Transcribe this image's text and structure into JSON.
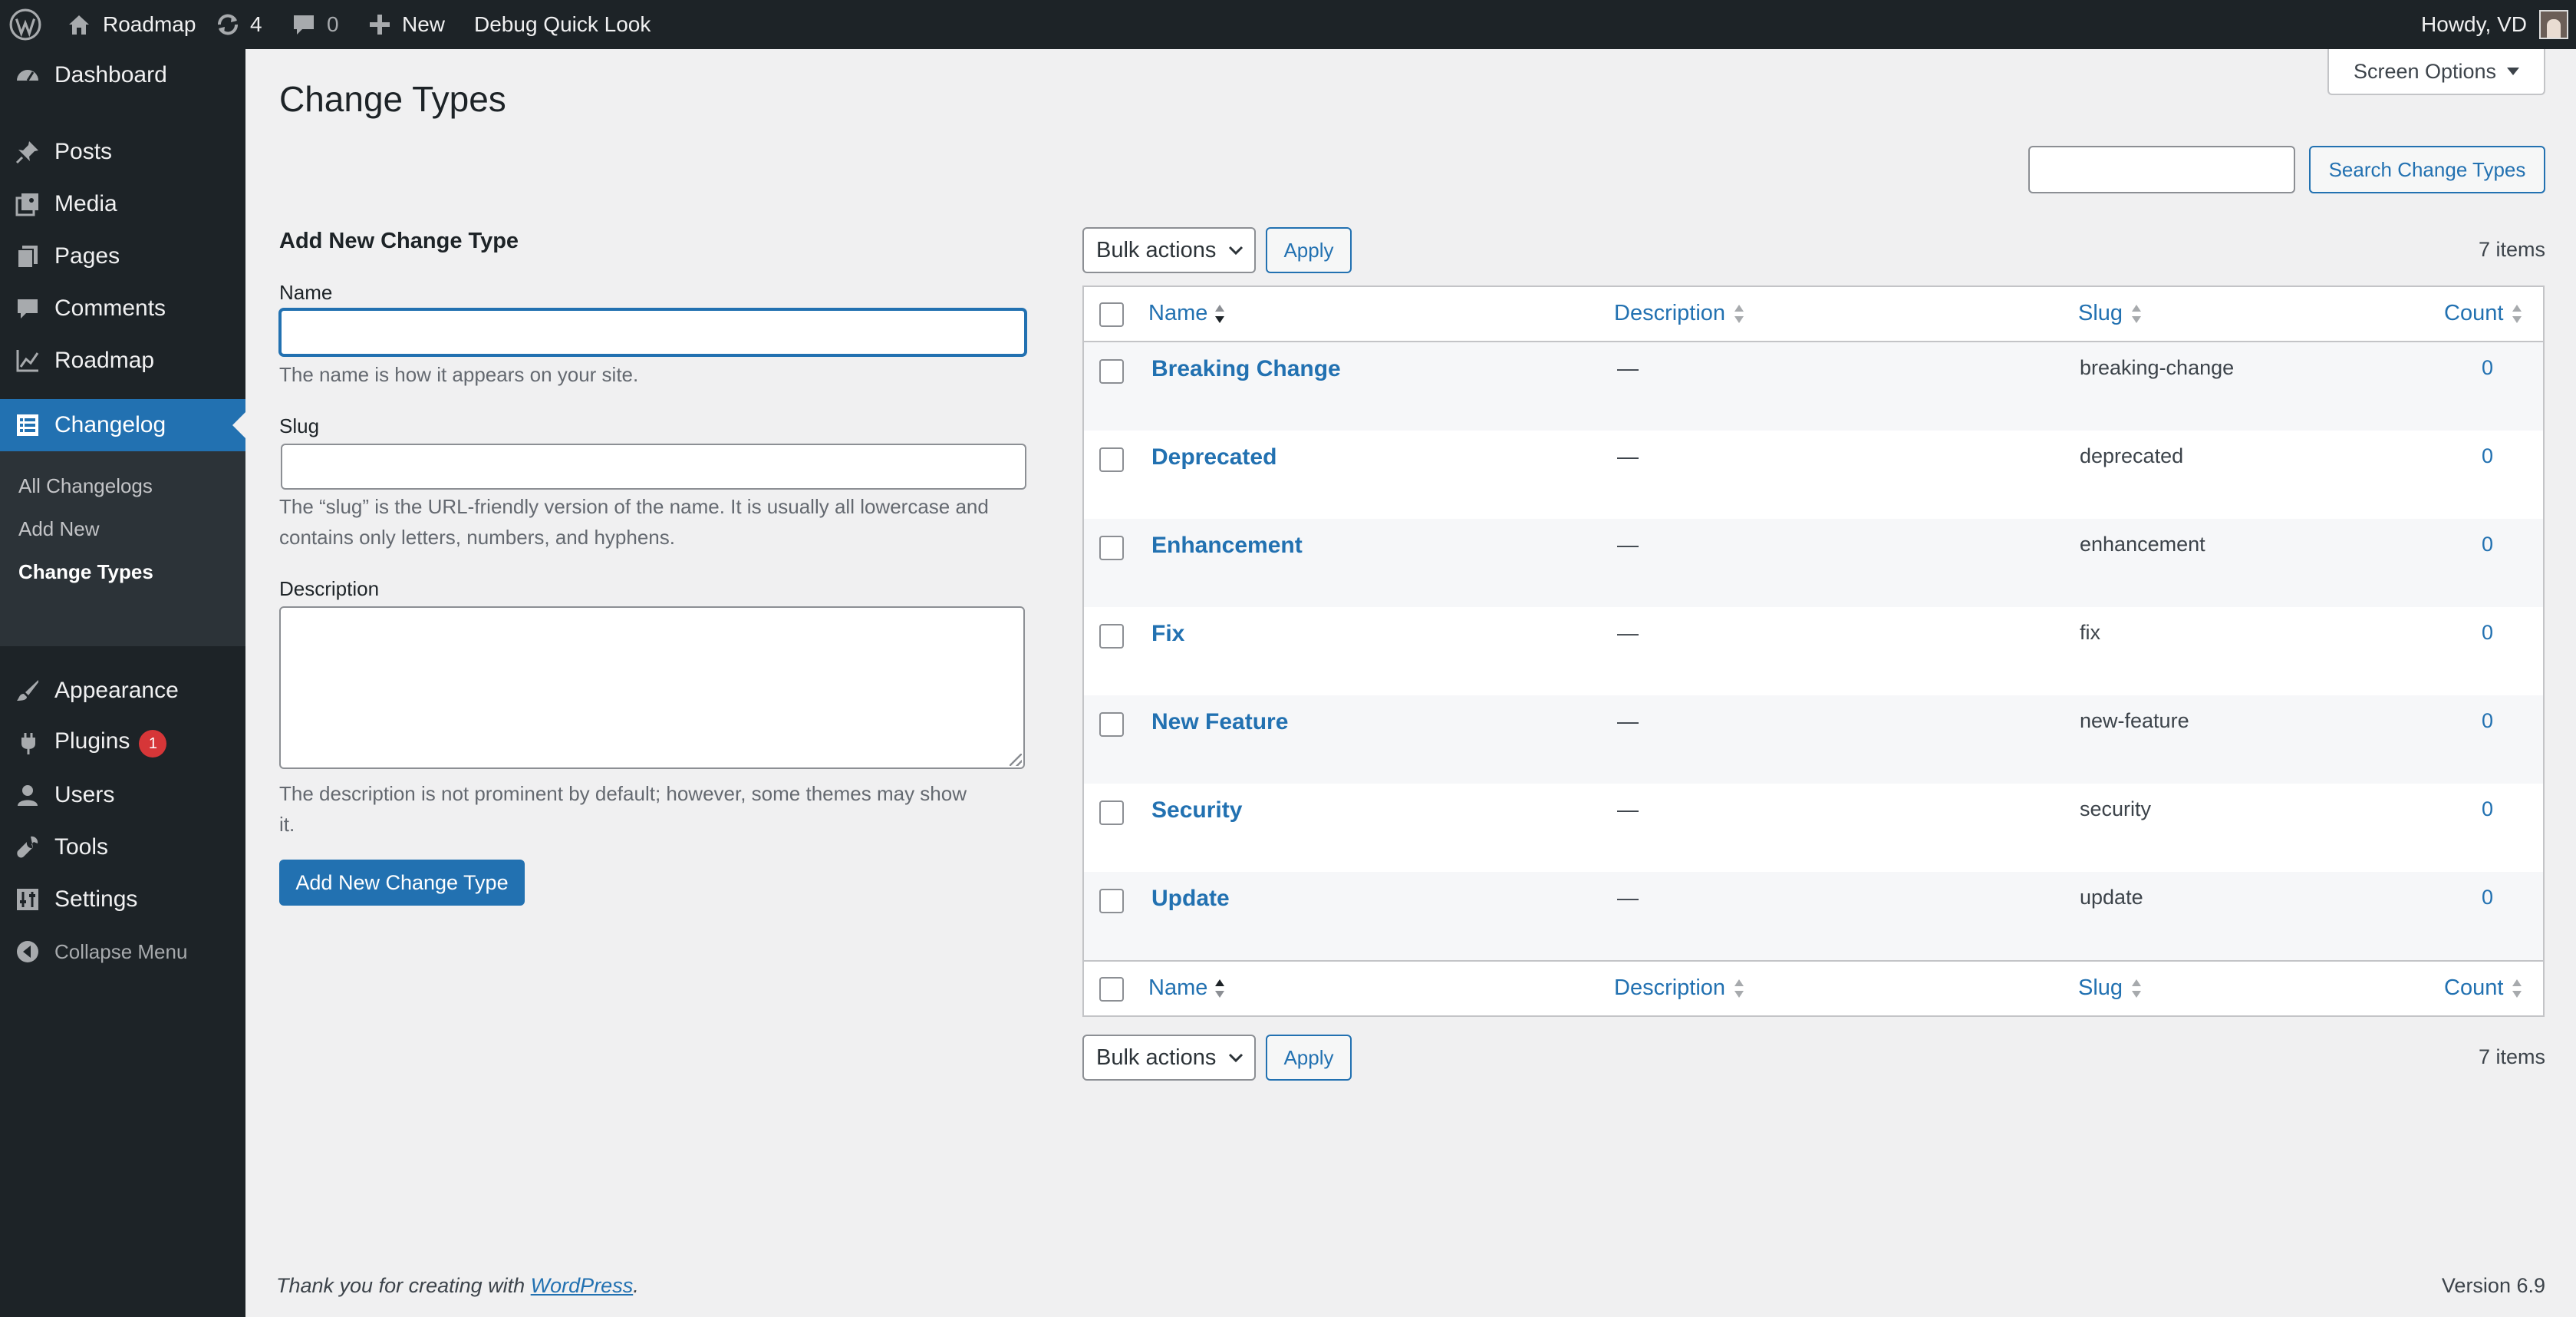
{
  "admin_bar": {
    "site_name": "Roadmap",
    "updates_count": "4",
    "comments_count": "0",
    "new_label": "New",
    "debug_label": "Debug Quick Look",
    "howdy": "Howdy, VD"
  },
  "sidebar": {
    "dashboard": "Dashboard",
    "posts": "Posts",
    "media": "Media",
    "pages": "Pages",
    "comments": "Comments",
    "roadmap": "Roadmap",
    "changelog": "Changelog",
    "submenu": [
      "All Changelogs",
      "Add New",
      "Change Types"
    ],
    "appearance": "Appearance",
    "plugins": "Plugins",
    "plugins_badge": "1",
    "users": "Users",
    "tools": "Tools",
    "settings": "Settings",
    "collapse": "Collapse Menu"
  },
  "page": {
    "title": "Change Types",
    "screen_options": "Screen Options",
    "search_button": "Search Change Types",
    "search_value": ""
  },
  "form": {
    "heading": "Add New Change Type",
    "name_label": "Name",
    "name_help": "The name is how it appears on your site.",
    "slug_label": "Slug",
    "slug_help_1": "The “slug” is the URL-friendly version of the name. It is usually all lowercase and",
    "slug_help_2": "contains only letters, numbers, and hyphens.",
    "desc_label": "Description",
    "desc_help_1": "The description is not prominent by default; however, some themes may show",
    "desc_help_2": "it.",
    "submit": "Add New Change Type"
  },
  "table": {
    "bulk_actions": "Bulk actions",
    "apply": "Apply",
    "items_count": "7 items",
    "columns": {
      "name": "Name",
      "description": "Description",
      "slug": "Slug",
      "count": "Count"
    },
    "rows": [
      {
        "name": "Breaking Change",
        "description": "—",
        "slug": "breaking-change",
        "count": "0"
      },
      {
        "name": "Deprecated",
        "description": "—",
        "slug": "deprecated",
        "count": "0"
      },
      {
        "name": "Enhancement",
        "description": "—",
        "slug": "enhancement",
        "count": "0"
      },
      {
        "name": "Fix",
        "description": "—",
        "slug": "fix",
        "count": "0"
      },
      {
        "name": "New Feature",
        "description": "—",
        "slug": "new-feature",
        "count": "0"
      },
      {
        "name": "Security",
        "description": "—",
        "slug": "security",
        "count": "0"
      },
      {
        "name": "Update",
        "description": "—",
        "slug": "update",
        "count": "0"
      }
    ]
  },
  "footer": {
    "thanks_prefix": "Thank you for creating with ",
    "wordpress_link": "WordPress",
    "thanks_suffix": ".",
    "version": "Version 6.9"
  },
  "colors": {
    "admin_dark": "#1d2327",
    "accent": "#2271b1",
    "badge": "#d63638"
  }
}
